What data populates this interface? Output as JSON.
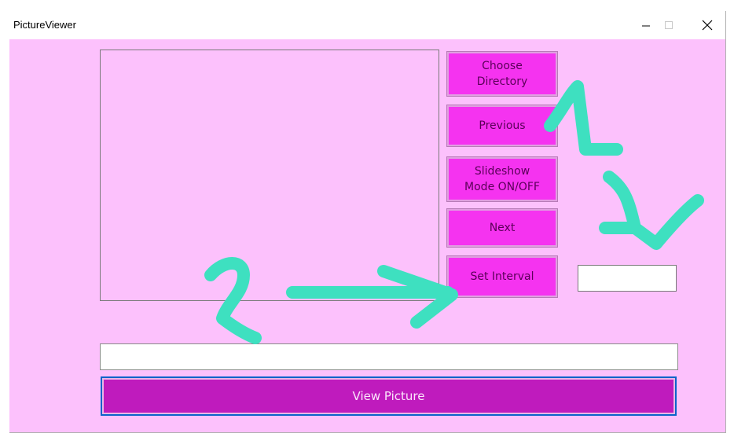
{
  "window": {
    "title": "PictureViewer"
  },
  "titlebar_buttons": {
    "minimize_icon": "minimize-icon",
    "maximize_icon": "maximize-icon",
    "close_icon": "close-icon"
  },
  "buttons": {
    "choose_directory": "Choose\nDirectory",
    "previous": "Previous",
    "slideshow": "Slideshow\nMode ON/OFF",
    "next": "Next",
    "set_interval": "Set Interval",
    "view_picture": "View Picture"
  },
  "inputs": {
    "interval_value": "",
    "path_value": ""
  },
  "annotations": {
    "number_1": "1",
    "number_2": "2",
    "color": "#3ee0c0"
  },
  "colors": {
    "window_bg": "#fcc1fc",
    "side_button_bg": "#f533f0",
    "view_button_bg": "#bf1bbd"
  }
}
